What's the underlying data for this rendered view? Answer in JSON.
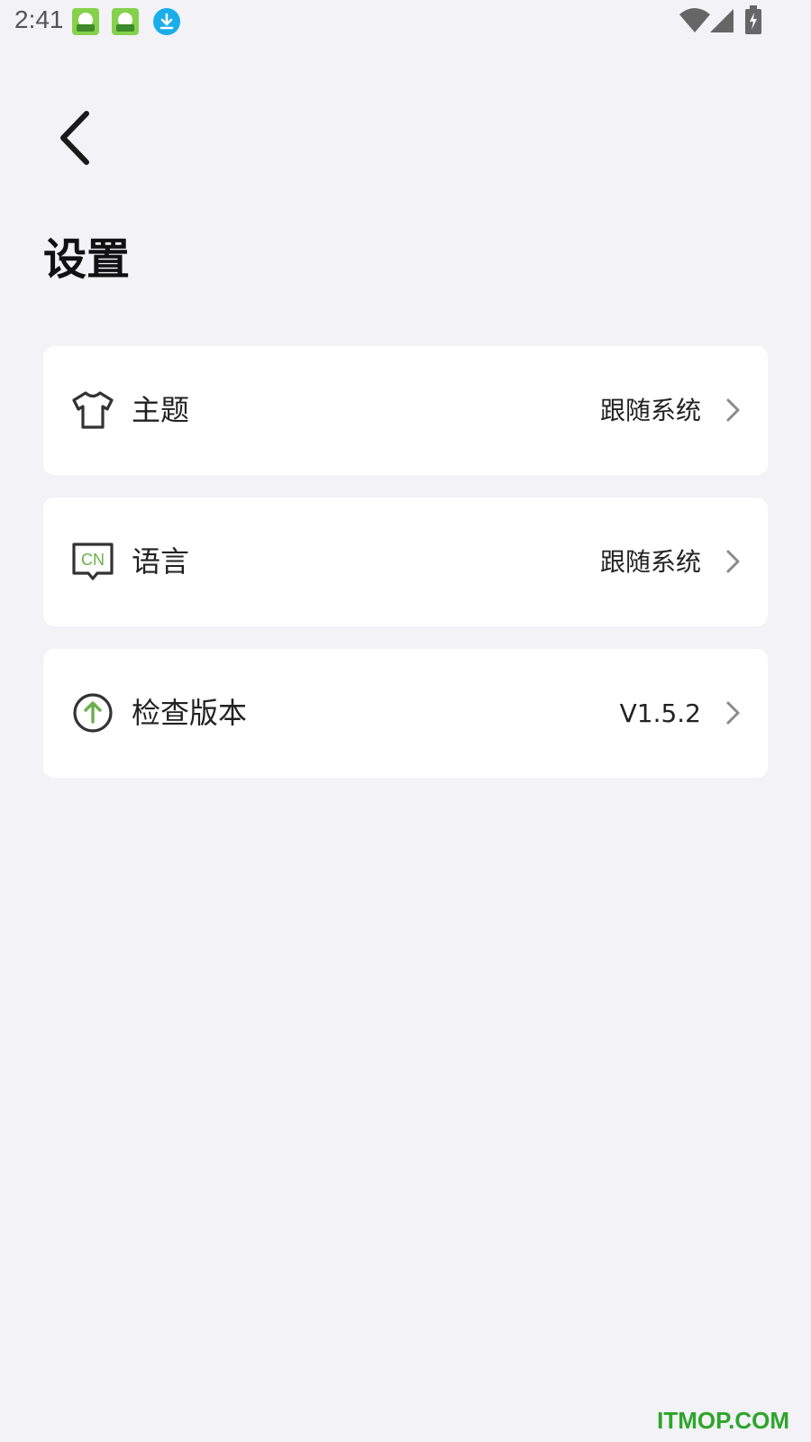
{
  "status_bar": {
    "time": "2:41",
    "icons": [
      "app-notification-icon",
      "app-notification-icon",
      "download-icon",
      "wifi-icon",
      "signal-icon",
      "battery-charging-icon"
    ]
  },
  "header": {
    "back_icon": "chevron-left-icon",
    "title": "设置"
  },
  "settings": {
    "items": [
      {
        "icon": "tshirt-icon",
        "label": "主题",
        "value": "跟随系统"
      },
      {
        "icon": "language-cn-icon",
        "label": "语言",
        "value": "跟随系统",
        "icon_text": "CN"
      },
      {
        "icon": "upload-circle-icon",
        "label": "检查版本",
        "value": "V1.5.2"
      }
    ]
  },
  "watermark": "ITMOP.COM",
  "colors": {
    "background": "#f2f2f7",
    "card": "#ffffff",
    "accent_green": "#6ab04c",
    "watermark": "#2ea52a"
  }
}
